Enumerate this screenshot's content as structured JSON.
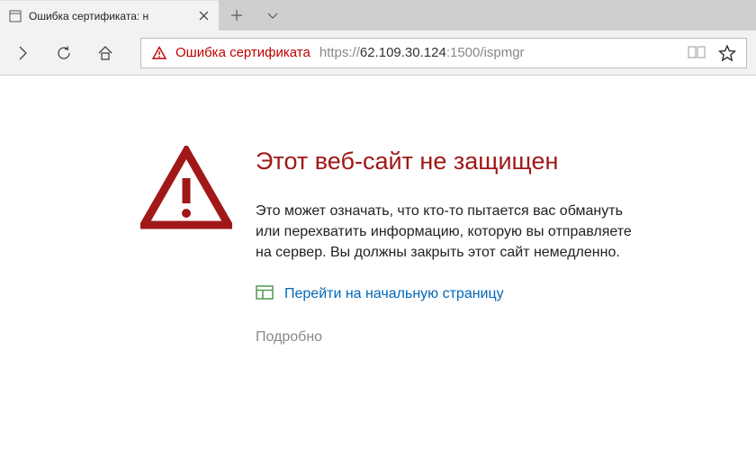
{
  "tab": {
    "title": "Ошибка сертификата: н"
  },
  "addressbar": {
    "cert_error": "Ошибка сертификата",
    "url_scheme": "https://",
    "url_host": "62.109.30.124",
    "url_port": ":1500",
    "url_path": "/ispmgr"
  },
  "page": {
    "heading": "Этот веб-сайт не защищен",
    "description": "Это может означать, что кто-то пытается вас обмануть или перехватить информацию, которую вы отправляете на сервер. Вы должны закрыть этот сайт немедленно.",
    "home_link": "Перейти на начальную страницу",
    "more": "Подробно"
  }
}
